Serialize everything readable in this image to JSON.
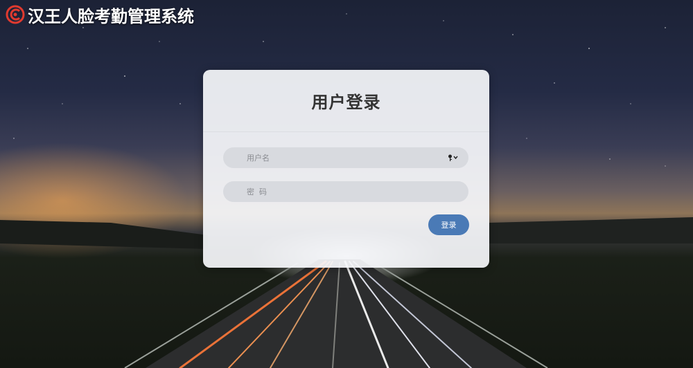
{
  "header": {
    "title": "汉王人脸考勤管理系统",
    "logo_icon": "hanvon-logo-icon"
  },
  "login": {
    "title": "用户登录",
    "username_placeholder": "用户名",
    "password_placeholder": "密  码",
    "key_icon": "key-dropdown-icon",
    "submit_label": "登录"
  },
  "colors": {
    "button": "#4a7ab6",
    "logo": "#e03a2f",
    "card": "#f5f6fa"
  }
}
